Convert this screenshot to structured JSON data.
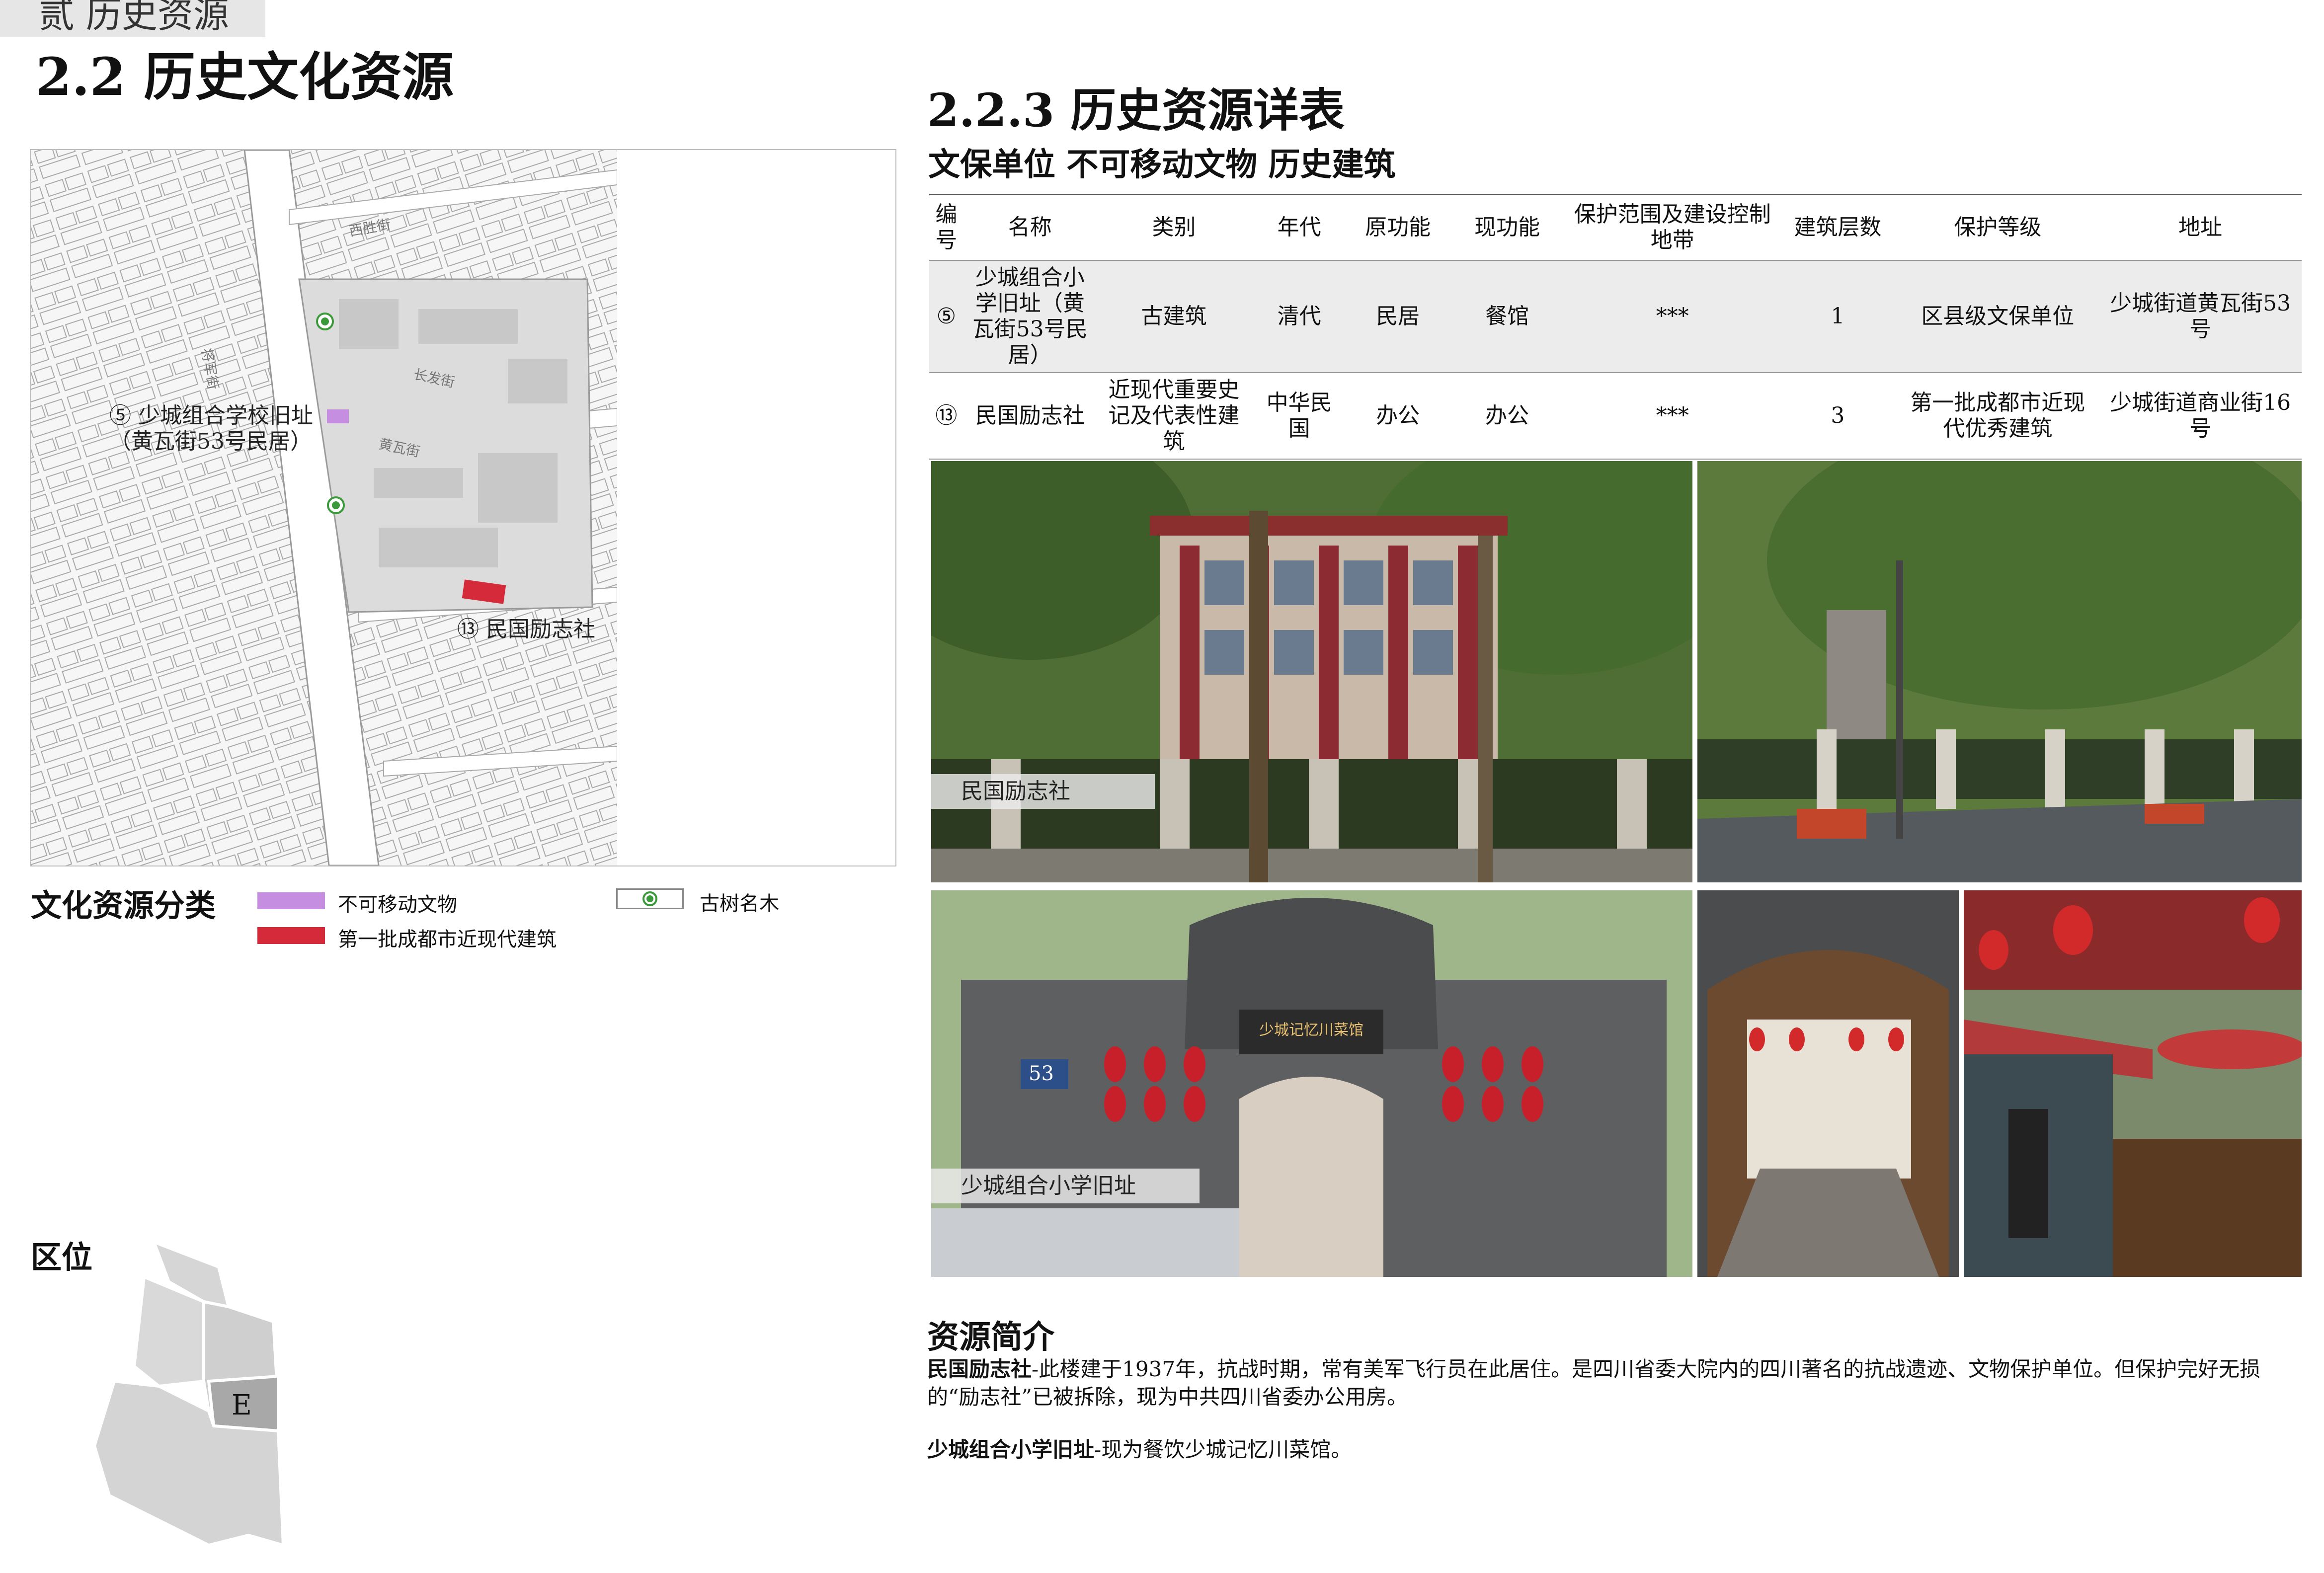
{
  "header": {
    "chapter_tab": "贰  历史资源",
    "section_title": "2.2 历史文化资源"
  },
  "map": {
    "labels": {
      "site5": "⑤ 少城组合学校旧址",
      "site5_sub": "（黄瓦街53号民居）",
      "site13": "⑬ 民国励志社",
      "street1": "长发街",
      "street2": "黄瓦街",
      "street3": "西胜街",
      "street4": "将军街"
    },
    "colors": {
      "immovable": "#c58ee0",
      "modern_building": "#d42a3a",
      "tree": "#3a9a3a"
    }
  },
  "legend": {
    "title": "文化资源分类",
    "items": [
      {
        "label": "不可移动文物",
        "color": "#c58ee0"
      },
      {
        "label": "第一批成都市近现代建筑",
        "color": "#d42a3a"
      },
      {
        "label": "古树名木",
        "icon": "tree-dot-icon"
      }
    ]
  },
  "location": {
    "title": "区位",
    "zone_label": "E"
  },
  "right": {
    "subsection_title": "2.2.3 历史资源详表",
    "table_caption": "文保单位 不可移动文物 历史建筑",
    "table": {
      "headers": [
        "编号",
        "名称",
        "类别",
        "年代",
        "原功能",
        "现功能",
        "保护范围及建设控制地带",
        "建筑层数",
        "保护等级",
        "地址"
      ],
      "rows": [
        [
          "⑤",
          "少城组合小学旧址（黄瓦街53号民居）",
          "古建筑",
          "清代",
          "民居",
          "餐馆",
          "***",
          "1",
          "区县级文保单位",
          "少城街道黄瓦街53号"
        ],
        [
          "⑬",
          "民国励志社",
          "近现代重要史记及代表性建筑",
          "中华民国",
          "办公",
          "办公",
          "***",
          "3",
          "第一批成都市近现代优秀建筑",
          "少城街道商业街16号"
        ]
      ]
    },
    "photos": {
      "label1": "民国励志社",
      "label2": "少城组合小学旧址",
      "sign_text": "少城记忆川菜馆",
      "door_number": "53"
    },
    "intro": {
      "title": "资源简介",
      "p1_name": "民国励志社",
      "p1_text": "-此楼建于1937年，抗战时期，常有美军飞行员在此居住。是四川省委大院内的四川著名的抗战遗迹、文物保护单位。但保护完好无损的“励志社”已被拆除，现为中共四川省委办公用房。",
      "p2_name": "少城组合小学旧址",
      "p2_text": "-现为餐饮少城记忆川菜馆。"
    }
  }
}
